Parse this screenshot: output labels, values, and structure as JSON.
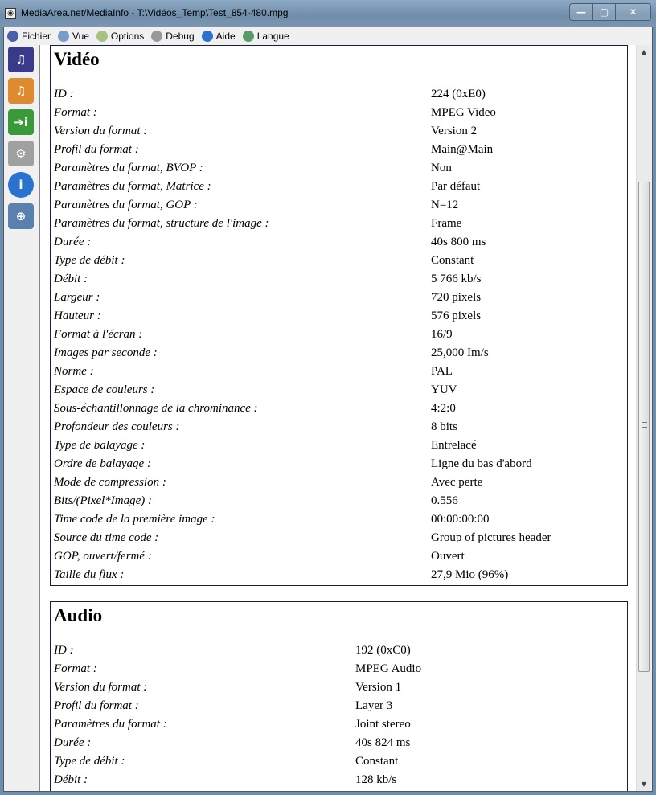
{
  "window": {
    "title": "MediaArea.net/MediaInfo - T:\\Vidéos_Temp\\Test_854-480.mpg",
    "controls": {
      "minimize": "—",
      "maximize": "▢",
      "close": "✕"
    }
  },
  "menu": [
    {
      "label": "Fichier",
      "icon": "file-icon",
      "color": "#4a5fa8"
    },
    {
      "label": "Vue",
      "icon": "view-icon",
      "color": "#7a9cc9"
    },
    {
      "label": "Options",
      "icon": "options-icon",
      "color": "#a8c080"
    },
    {
      "label": "Debug",
      "icon": "debug-icon",
      "color": "#999999"
    },
    {
      "label": "Aide",
      "icon": "help-icon",
      "color": "#2a72d0"
    },
    {
      "label": "Langue",
      "icon": "globe-icon",
      "color": "#5a9a6a"
    }
  ],
  "sidebar": [
    {
      "icon": "open-file-icon",
      "glyph": "♫",
      "color": "#3a3a8a"
    },
    {
      "icon": "open-folder-icon",
      "glyph": "♫",
      "color": "#e08a30"
    },
    {
      "icon": "export-icon",
      "glyph": "➔i",
      "color": "#3a9a3a"
    },
    {
      "icon": "preferences-icon",
      "glyph": "⚙",
      "color": "#a0a0a0"
    },
    {
      "icon": "about-icon",
      "glyph": "i",
      "color": "#2a72d0"
    },
    {
      "icon": "web-icon",
      "glyph": "⊕",
      "color": "#5a80b0"
    }
  ],
  "video": {
    "title": "Vidéo",
    "rows": [
      [
        "ID :",
        "224 (0xE0)"
      ],
      [
        "Format :",
        "MPEG Video"
      ],
      [
        "Version du format :",
        "Version 2"
      ],
      [
        "Profil du format :",
        "Main@Main"
      ],
      [
        "Paramètres du format, BVOP :",
        "Non"
      ],
      [
        "Paramètres du format, Matrice :",
        "Par défaut"
      ],
      [
        "Paramètres du format, GOP :",
        "N=12"
      ],
      [
        "Paramètres du format, structure de l'image :",
        "Frame"
      ],
      [
        "Durée :",
        "40s 800 ms"
      ],
      [
        "Type de débit :",
        "Constant"
      ],
      [
        "Débit :",
        "5 766 kb/s"
      ],
      [
        "Largeur :",
        "720 pixels"
      ],
      [
        "Hauteur :",
        "576 pixels"
      ],
      [
        "Format à l'écran :",
        "16/9"
      ],
      [
        "Images par seconde :",
        "25,000 Im/s"
      ],
      [
        "Norme :",
        "PAL"
      ],
      [
        "Espace de couleurs :",
        "YUV"
      ],
      [
        "Sous-échantillonnage de la chrominance :",
        "4:2:0"
      ],
      [
        "Profondeur des couleurs :",
        "8 bits"
      ],
      [
        "Type de balayage :",
        "Entrelacé"
      ],
      [
        "Ordre de balayage :",
        "Ligne du bas d'abord"
      ],
      [
        "Mode de compression :",
        "Avec perte"
      ],
      [
        "Bits/(Pixel*Image) :",
        "0.556"
      ],
      [
        "Time code de la première image :",
        "00:00:00:00"
      ],
      [
        "Source du time code :",
        "Group of pictures header"
      ],
      [
        "GOP, ouvert/fermé :",
        "Ouvert"
      ],
      [
        "Taille du flux :",
        "27,9 Mio (96%)"
      ]
    ]
  },
  "audio": {
    "title": "Audio",
    "rows": [
      [
        "ID :",
        "192 (0xC0)"
      ],
      [
        "Format :",
        "MPEG Audio"
      ],
      [
        "Version du format :",
        "Version 1"
      ],
      [
        "Profil du format :",
        "Layer 3"
      ],
      [
        "Paramètres du format :",
        "Joint stereo"
      ],
      [
        "Durée :",
        "40s 824 ms"
      ],
      [
        "Type de débit :",
        "Constant"
      ],
      [
        "Débit :",
        "128 kb/s"
      ]
    ]
  },
  "scrollbar": {
    "up": "▲",
    "down": "▼",
    "position_fraction": 0.2
  }
}
